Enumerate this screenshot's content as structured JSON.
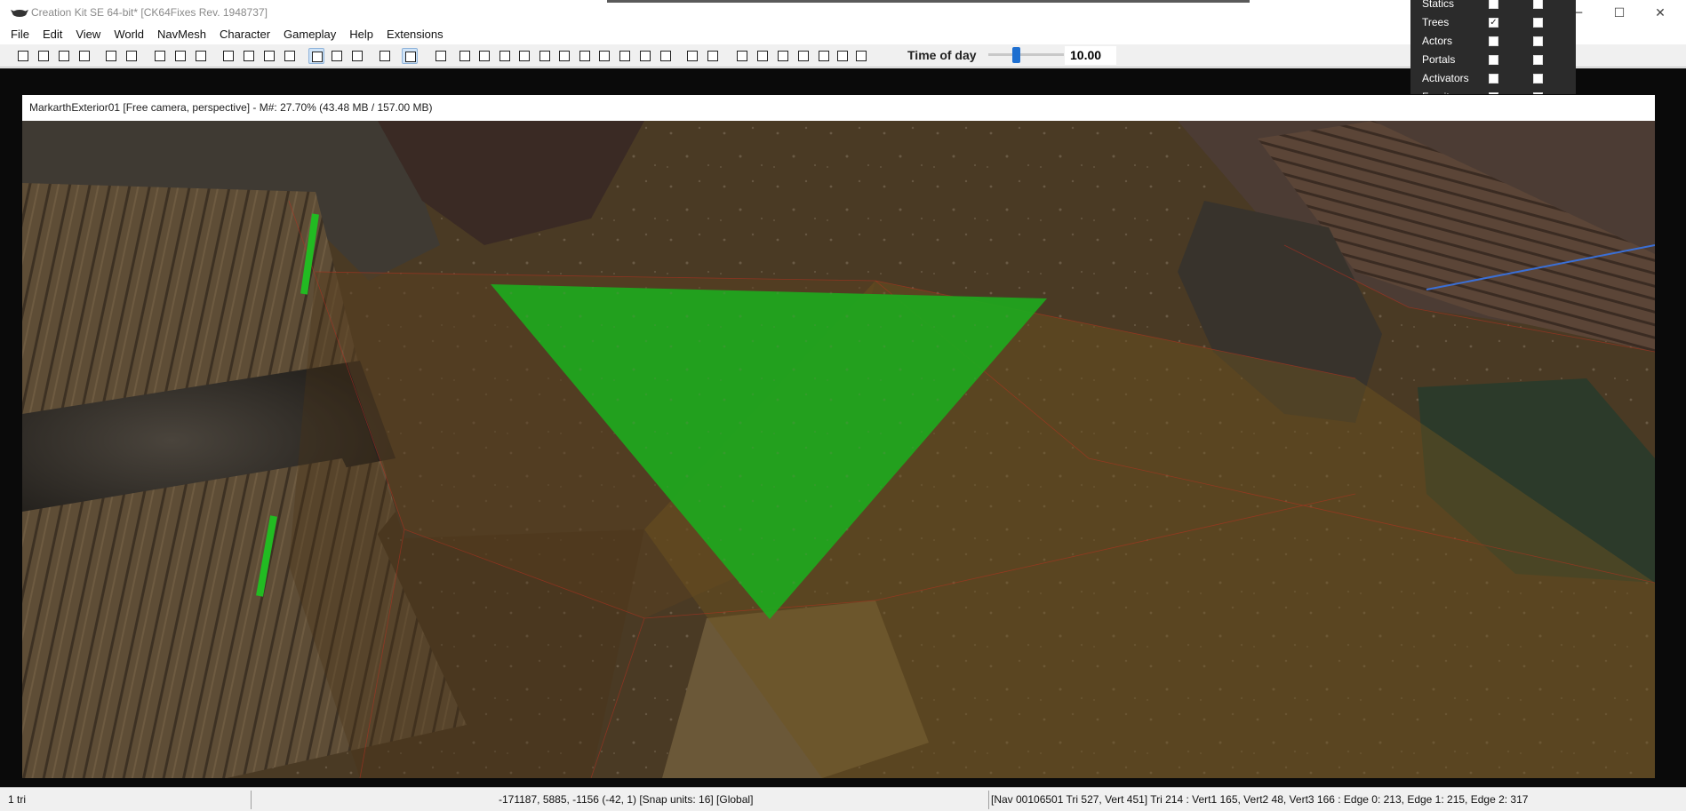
{
  "window": {
    "title": "Creation Kit SE 64-bit* [CK64Fixes Rev. 1948737]",
    "minimize_glyph": "─",
    "maximize_glyph": "☐",
    "close_glyph": "✕"
  },
  "menu": [
    "File",
    "Edit",
    "View",
    "World",
    "NavMesh",
    "Character",
    "Gameplay",
    "Help",
    "Extensions"
  ],
  "time_of_day": {
    "label": "Time of day",
    "value": "10.00",
    "slider_fraction": 0.37
  },
  "viewport": {
    "header": "MarkarthExterior01 [Free camera, perspective] - M#: 27.70% (43.48 MB / 157.00 MB)"
  },
  "render_window": {
    "rows": [
      {
        "label": "Statics",
        "checked": false
      },
      {
        "label": "Trees",
        "checked": true
      },
      {
        "label": "Actors",
        "checked": false
      },
      {
        "label": "Portals",
        "checked": false
      },
      {
        "label": "Activators",
        "checked": false
      },
      {
        "label": "Furniture",
        "checked": false
      }
    ],
    "check_glyph": "✓"
  },
  "status": {
    "selection": "1 tri",
    "coords": "-171187, 5885, -1156 (-42, 1) [Snap units: 16] [Global]",
    "nav_info": "[Nav 00106501 Tri 527, Vert 451] Tri 214 : Vert1 165, Vert2 48, Vert3 166 : Edge 0: 213, Edge 1: 215, Edge 2: 317"
  },
  "colors": {
    "selected_triangle": "#1ea81e",
    "navmesh_overlay": "#b8860b",
    "ground": "#4a3a24",
    "slider_thumb": "#1e6fd0"
  },
  "toolbar_icons": [
    "new-icon",
    "open-icon",
    "save-icon",
    "preferences-icon",
    "undo-icon",
    "redo-icon",
    "render-icon",
    "render-light-icon",
    "render-sky-icon",
    "landscape-icon",
    "world-map-icon",
    "cell-view-icon",
    "object-palette-icon",
    "select-icon",
    "move-icon",
    "rotate-icon",
    "snap-grid-icon",
    "snap-angle-icon",
    "marker-icon",
    "navmesh-1-icon",
    "navmesh-2-icon",
    "navmesh-3-icon",
    "navmesh-4-icon",
    "navmesh-5-icon",
    "navmesh-6-icon",
    "navmesh-7-icon",
    "navmesh-8-icon",
    "navmesh-9-icon",
    "navmesh-10-icon",
    "navmesh-11-icon",
    "navmesh-12-icon",
    "navmesh-13-icon",
    "navmesh-14-icon",
    "navmesh-15-icon",
    "navmesh-16-icon",
    "navmesh-17-icon",
    "navmesh-18-icon",
    "navmesh-19-icon",
    "navmesh-20-icon"
  ]
}
